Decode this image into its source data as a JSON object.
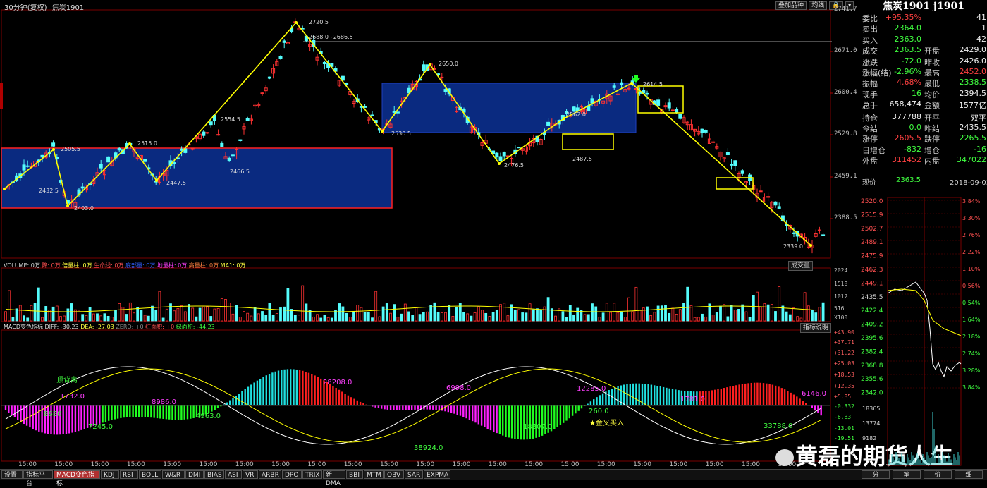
{
  "window": {
    "period_label": "30分钟(复权)",
    "instrument": "焦炭1901",
    "toolbar_buttons": [
      "叠加品种",
      "均线"
    ]
  },
  "price_axis": [
    "2741.7",
    "2671.0",
    "2600.4",
    "2529.8",
    "2459.1",
    "2388.5"
  ],
  "price_annotations": [
    {
      "value": "2720.5"
    },
    {
      "value": "2688.0~2686.5"
    },
    {
      "value": "2650.0"
    },
    {
      "value": "2614.5"
    },
    {
      "value": "2562.0"
    },
    {
      "value": "2554.5"
    },
    {
      "value": "2530.5"
    },
    {
      "value": "2515.0"
    },
    {
      "value": "2505.5"
    },
    {
      "value": "2487.5"
    },
    {
      "value": "2476.5"
    },
    {
      "value": "2466.5"
    },
    {
      "value": "2447.5"
    },
    {
      "value": "2432.5"
    },
    {
      "value": "2403.0"
    },
    {
      "value": "2339.0"
    }
  ],
  "volume_panel": {
    "legend": [
      "VOLUME: 0万",
      "降: 0万",
      "倍量柱: 0万",
      "生命线: 0万",
      "底部量: 0万",
      "地量柱: 0万",
      "高量柱: 0万",
      "MA1: 0万"
    ],
    "axis": [
      "2024",
      "1518",
      "1012",
      "516",
      "X100"
    ],
    "button": "成交量",
    "marker_char": "倍",
    "high_char": "高"
  },
  "macd_panel": {
    "legend": [
      "MACD变色指标 DIFF: -30.23",
      "DEA: -27.03",
      "ZERO: +0",
      "红面积: +0",
      "绿面积: -44.23"
    ],
    "button": "指标说明",
    "axis": [
      "+43.90",
      "+37.71",
      "+31.22",
      "+25.03",
      "+18.53",
      "+12.35",
      "+5.85",
      "-0.332",
      "-6.83",
      "-13.01",
      "-19.51"
    ],
    "annotations": [
      "顶背离",
      "1732.0",
      "8680",
      "8986.0",
      "7245.0",
      "4963.0",
      "28208.0",
      "38924.0",
      "6998.0",
      "18307.0",
      "12285.0",
      "260.0",
      "金叉买入",
      "1781.0",
      "33788.0",
      "6146.0"
    ]
  },
  "time_labels": [
    "15:00",
    "15:00",
    "15:00",
    "15:00",
    "15:00",
    "15:00",
    "15:00",
    "15:00",
    "15:00",
    "15:00",
    "15:00",
    "15:00",
    "15:00",
    "15:00",
    "15:00",
    "15:00",
    "15:00",
    "15:00",
    "15:00",
    "15:00",
    "15:00",
    "15:00"
  ],
  "tabs": [
    "设置",
    "指标平台",
    "MACD变色指标",
    "KDJ",
    "RSI",
    "BOLL",
    "W&R",
    "DMI",
    "BIAS",
    "ASI",
    "VR",
    "ARBR",
    "DPO",
    "TRIX",
    "新DMA",
    "BBI",
    "MTM",
    "OBV",
    "SAR",
    "EXPMA"
  ],
  "sidebar": {
    "title": "焦炭1901 j1901",
    "rows": [
      {
        "l1": "委比",
        "v1": "+95.35%",
        "l2": "",
        "v2": "41"
      },
      {
        "l1": "卖出",
        "v1": "2364.0",
        "l2": "",
        "v2": "1"
      },
      {
        "l1": "买入",
        "v1": "2363.0",
        "l2": "",
        "v2": "42"
      },
      {
        "l1": "成交",
        "v1": "2363.5",
        "l2": "开盘",
        "v2": "2429.0"
      },
      {
        "l1": "涨跌",
        "v1": "-72.0",
        "l2": "昨收",
        "v2": "2426.0"
      },
      {
        "l1": "涨幅(结)",
        "v1": "-2.96%",
        "l2": "最高",
        "v2": "2452.0"
      },
      {
        "l1": "振幅",
        "v1": "4.68%",
        "l2": "最低",
        "v2": "2338.5"
      },
      {
        "l1": "现手",
        "v1": "16",
        "l2": "均价",
        "v2": "2394.5"
      },
      {
        "l1": "总手",
        "v1": "658,474",
        "l2": "金额",
        "v2": "1577亿"
      },
      {
        "l1": "持仓",
        "v1": "377788",
        "l2": "开平",
        "v2": "双平"
      },
      {
        "l1": "今结",
        "v1": "0.0",
        "l2": "昨结",
        "v2": "2435.5"
      },
      {
        "l1": "涨停",
        "v1": "2605.5",
        "l2": "跌停",
        "v2": "2265.5"
      },
      {
        "l1": "日增仓",
        "v1": "-832",
        "l2": "增仓",
        "v2": "-16"
      },
      {
        "l1": "外盘",
        "v1": "311452",
        "l2": "内盘",
        "v2": "347022"
      }
    ],
    "price_line": {
      "label": "现价",
      "value": "2363.5",
      "date": "2018-09-03,一"
    },
    "mini_left_axis": [
      "2520.0",
      "2515.9",
      "2502.7",
      "2489.1",
      "2475.9",
      "2462.3",
      "2449.1",
      "2435.5",
      "2422.4",
      "2409.2",
      "2395.6",
      "2382.4",
      "2368.8",
      "2355.6",
      "2342.0"
    ],
    "mini_right_axis": [
      "3.84%",
      "3.30%",
      "2.76%",
      "2.22%",
      "1.10%",
      "0.56%",
      "0.54%",
      "1.64%",
      "2.18%",
      "2.74%",
      "3.28%",
      "3.84%"
    ],
    "mini_volume_axis": [
      "18365",
      "13774",
      "9182"
    ]
  },
  "watermark": "黄磊的期货人生",
  "bottom_right_chars": [
    "分",
    "笔",
    "价",
    "细"
  ],
  "colors": {
    "up": "#ff3232",
    "down": "#54fcfc",
    "ma": "#ffff00",
    "box_fill": "#0a2a80",
    "box_border": "#ff2020",
    "text_gray": "#c0c0c0"
  }
}
